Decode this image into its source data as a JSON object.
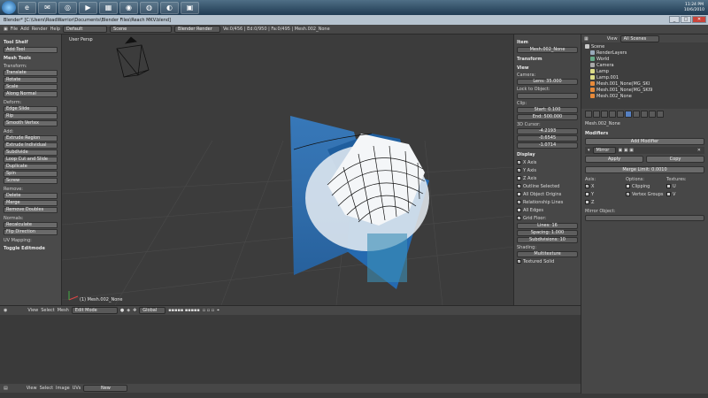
{
  "taskbar": {
    "apps": [
      "e",
      "✉",
      "◎",
      "▶",
      "▦",
      "◉",
      "◍",
      "◐",
      "▣"
    ],
    "clock_time": "11:24 PM",
    "clock_date": "10/6/2010"
  },
  "window": {
    "title": "Blender* [C:\\Users\\RoadWarrior\\Documents\\Blender Files\\Reach MKV.blend]"
  },
  "header": {
    "menus": [
      "File",
      "Add",
      "Render",
      "Help"
    ],
    "layout": "Default",
    "scene": "Scene",
    "engine": "Blender Render",
    "stats": "Ve:0/456 | Ed:0/950 | Fa:0/495 | Mesh.002_None"
  },
  "toolshelf": {
    "title": "Tool Shelf",
    "add_tool": "Add Tool",
    "mesh_tools": "Mesh Tools",
    "transform_label": "Transform:",
    "transform": [
      "Translate",
      "Rotate",
      "Scale",
      "Along Normal"
    ],
    "deform_label": "Deform:",
    "deform": [
      "Edge Slide",
      "Rip",
      "Smooth Vertex"
    ],
    "add_label": "Add:",
    "add": [
      "Extrude Region",
      "Extrude Individual",
      "Subdivide",
      "Loop Cut and Slide",
      "Duplicate",
      "Spin",
      "Screw"
    ],
    "remove_label": "Remove:",
    "remove": [
      "Delete",
      "Merge",
      "Remove Doubles"
    ],
    "normals_label": "Normals:",
    "normals": [
      "Recalculate",
      "Flip Direction"
    ],
    "uv_label": "UV Mapping:",
    "toggle": "Toggle Editmode"
  },
  "viewport": {
    "label": "User Persp",
    "object": "(1) Mesh.002_None"
  },
  "npanel": {
    "item": "Item",
    "item_name": "Mesh.002_None",
    "transform": "Transform",
    "view": "View",
    "camera": "Camera:",
    "lens": "Lens: 35.000",
    "lock": "Lock to Object:",
    "clip": "Clip:",
    "clip_start": "Start: 0.100",
    "clip_end": "End: 500.000",
    "cursor": "3D Cursor:",
    "cx": "-4.2193",
    "cy": "-0.6545",
    "cz": "-1.0714",
    "display": "Display",
    "checks": [
      "X Axis",
      "Y Axis",
      "Z Axis",
      "Outline Selected",
      "All Object Origins",
      "Relationship Lines",
      "All Edges"
    ],
    "grid_floor": "Grid Floor:",
    "lines": "Lines: 16",
    "spacing": "Spacing: 1.000",
    "subdiv": "Subdivisions: 10",
    "shading": "Shading:",
    "shading_val": "Multitexture",
    "textured": "Textured Solid"
  },
  "vheader": {
    "items": [
      "View",
      "Select",
      "Mesh"
    ],
    "mode": "Edit Mode",
    "pivot": "Global"
  },
  "bheader": {
    "items": [
      "View",
      "Select",
      "Image",
      "UVs"
    ],
    "new": "New"
  },
  "outliner": {
    "view": "View",
    "search": "All Scenes",
    "rows": [
      {
        "name": "Scene",
        "color": "#c8c8c8"
      },
      {
        "name": "RenderLayers",
        "color": "#9ab"
      },
      {
        "name": "World",
        "color": "#6a8"
      },
      {
        "name": "Camera",
        "color": "#aaa"
      },
      {
        "name": "Lamp",
        "color": "#dd8"
      },
      {
        "name": "Lamp.001",
        "color": "#dd8"
      },
      {
        "name": "Mesh.001_None|MG_SKI",
        "color": "#e88a3a"
      },
      {
        "name": "Mesh.001_None|MG_SKI9",
        "color": "#e88a3a"
      },
      {
        "name": "Mesh.002_None",
        "color": "#e88a3a"
      }
    ]
  },
  "props": {
    "object": "Mesh.002_None",
    "modifiers": "Modifiers",
    "add_modifier": "Add Modifier",
    "mirror": "Mirror",
    "apply": "Apply",
    "copy": "Copy",
    "merge_limit": "Merge Limit: 0.0010",
    "axis_label": "Axis:",
    "options_label": "Options:",
    "textures_label": "Textures:",
    "axes": [
      "X",
      "Y",
      "Z"
    ],
    "options": [
      "Clipping",
      "Vertex Groups"
    ],
    "textures": [
      "U",
      "V"
    ],
    "mirror_object": "Mirror Object:"
  }
}
